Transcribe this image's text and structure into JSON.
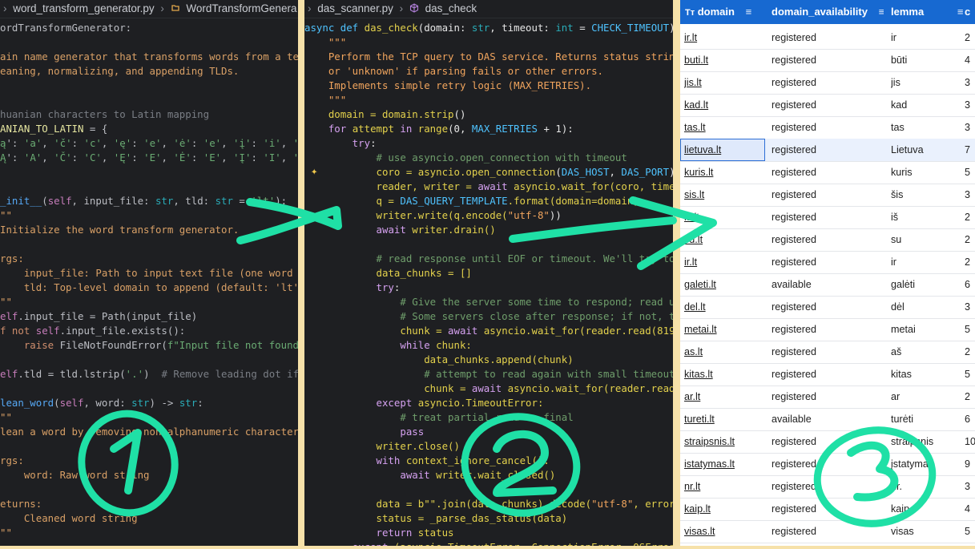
{
  "panel1": {
    "breadcrumb": {
      "file": "word_transform_generator.py",
      "symbol": "WordTransformGenera"
    },
    "lines": [
      [
        {
          "t": "ordTransformGenerator:",
          "c": "o"
        }
      ],
      [],
      [
        {
          "t": "ain name generator that transforms words from a text",
          "c": "d"
        }
      ],
      [
        {
          "t": "eaning, normalizing, and appending TLDs.",
          "c": "d"
        }
      ],
      [],
      [],
      [
        {
          "t": "huanian characters to Latin mapping",
          "c": "c"
        }
      ],
      [
        {
          "t": "ANIAN_TO_LATIN",
          "c": "y"
        },
        {
          "t": " = {",
          "c": "o"
        }
      ],
      [
        {
          "t": "ą",
          "c": "s"
        },
        {
          "t": "': ",
          "c": "o"
        },
        {
          "t": "'a'",
          "c": "s"
        },
        {
          "t": ", ",
          "c": "o"
        },
        {
          "t": "'č'",
          "c": "s"
        },
        {
          "t": ": ",
          "c": "o"
        },
        {
          "t": "'c'",
          "c": "s"
        },
        {
          "t": ", ",
          "c": "o"
        },
        {
          "t": "'ę'",
          "c": "s"
        },
        {
          "t": ": ",
          "c": "o"
        },
        {
          "t": "'e'",
          "c": "s"
        },
        {
          "t": ", ",
          "c": "o"
        },
        {
          "t": "'ė'",
          "c": "s"
        },
        {
          "t": ": ",
          "c": "o"
        },
        {
          "t": "'e'",
          "c": "s"
        },
        {
          "t": ", ",
          "c": "o"
        },
        {
          "t": "'į'",
          "c": "s"
        },
        {
          "t": ": ",
          "c": "o"
        },
        {
          "t": "'i'",
          "c": "s"
        },
        {
          "t": ", ",
          "c": "o"
        },
        {
          "t": "'š'",
          "c": "s"
        }
      ],
      [
        {
          "t": "Ą",
          "c": "s"
        },
        {
          "t": "': ",
          "c": "o"
        },
        {
          "t": "'A'",
          "c": "s"
        },
        {
          "t": ", ",
          "c": "o"
        },
        {
          "t": "'Č'",
          "c": "s"
        },
        {
          "t": ": ",
          "c": "o"
        },
        {
          "t": "'C'",
          "c": "s"
        },
        {
          "t": ", ",
          "c": "o"
        },
        {
          "t": "'Ę'",
          "c": "s"
        },
        {
          "t": ": ",
          "c": "o"
        },
        {
          "t": "'E'",
          "c": "s"
        },
        {
          "t": ", ",
          "c": "o"
        },
        {
          "t": "'Ė'",
          "c": "s"
        },
        {
          "t": ": ",
          "c": "o"
        },
        {
          "t": "'E'",
          "c": "s"
        },
        {
          "t": ", ",
          "c": "o"
        },
        {
          "t": "'Į'",
          "c": "s"
        },
        {
          "t": ": ",
          "c": "o"
        },
        {
          "t": "'I'",
          "c": "s"
        },
        {
          "t": ", ",
          "c": "o"
        },
        {
          "t": "'Š'",
          "c": "s"
        }
      ],
      [],
      [],
      [
        {
          "t": "_init__",
          "c": "f"
        },
        {
          "t": "(",
          "c": "o"
        },
        {
          "t": "self",
          "c": "m"
        },
        {
          "t": ", input_file: ",
          "c": "o"
        },
        {
          "t": "str",
          "c": "n"
        },
        {
          "t": ", tld: ",
          "c": "o"
        },
        {
          "t": "str",
          "c": "n"
        },
        {
          "t": " = ",
          "c": "o"
        },
        {
          "t": "'lt'",
          "c": "s"
        },
        {
          "t": "):",
          "c": "o"
        }
      ],
      [
        {
          "t": "\"\"",
          "c": "d"
        }
      ],
      [
        {
          "t": "Initialize the word transform generator.",
          "c": "d"
        }
      ],
      [],
      [
        {
          "t": "rgs:",
          "c": "d"
        }
      ],
      [
        {
          "t": "    input_file: Path to input text file (one word per",
          "c": "d"
        }
      ],
      [
        {
          "t": "    tld: Top-level domain to append (default: 'lt')",
          "c": "d"
        }
      ],
      [
        {
          "t": "\"\"",
          "c": "d"
        }
      ],
      [
        {
          "t": "elf",
          "c": "m"
        },
        {
          "t": ".input_file = Path(input_file)",
          "c": "o"
        }
      ],
      [
        {
          "t": "f ",
          "c": "k"
        },
        {
          "t": "not ",
          "c": "k"
        },
        {
          "t": "self",
          "c": "m"
        },
        {
          "t": ".input_file.exists():",
          "c": "o"
        }
      ],
      [
        {
          "t": "    ",
          "c": "o"
        },
        {
          "t": "raise ",
          "c": "k"
        },
        {
          "t": "FileNotFoundError(",
          "c": "o"
        },
        {
          "t": "f\"Input file not found: {",
          "c": "s"
        }
      ],
      [],
      [
        {
          "t": "elf",
          "c": "m"
        },
        {
          "t": ".tld = tld.lstrip(",
          "c": "o"
        },
        {
          "t": "'.'",
          "c": "s"
        },
        {
          "t": ")  ",
          "c": "o"
        },
        {
          "t": "# Remove leading dot if p",
          "c": "c"
        }
      ],
      [],
      [
        {
          "t": "lean_word",
          "c": "f"
        },
        {
          "t": "(",
          "c": "o"
        },
        {
          "t": "self",
          "c": "m"
        },
        {
          "t": ", word: ",
          "c": "o"
        },
        {
          "t": "str",
          "c": "n"
        },
        {
          "t": ") -> ",
          "c": "o"
        },
        {
          "t": "str",
          "c": "n"
        },
        {
          "t": ":",
          "c": "o"
        }
      ],
      [
        {
          "t": "\"\"",
          "c": "d"
        }
      ],
      [
        {
          "t": "lean a word by removing non-alphanumeric characters",
          "c": "d"
        }
      ],
      [],
      [
        {
          "t": "rgs:",
          "c": "d"
        }
      ],
      [
        {
          "t": "    word: Raw word string",
          "c": "d"
        }
      ],
      [],
      [
        {
          "t": "eturns:",
          "c": "d"
        }
      ],
      [
        {
          "t": "    Cleaned word string",
          "c": "d"
        }
      ],
      [
        {
          "t": "\"\"",
          "c": "d"
        }
      ]
    ]
  },
  "panel2": {
    "breadcrumb": {
      "file": "das_scanner.py",
      "symbol": "das_check"
    },
    "lines": [
      [
        {
          "t": "async ",
          "c": "bl"
        },
        {
          "t": "def ",
          "c": "bl"
        },
        {
          "t": "das_check",
          "c": "gy"
        },
        {
          "t": "(domain: ",
          "c": "wh"
        },
        {
          "t": "str",
          "c": "n"
        },
        {
          "t": ", timeout: ",
          "c": "wh"
        },
        {
          "t": "int",
          "c": "n"
        },
        {
          "t": " = ",
          "c": "wh"
        },
        {
          "t": "CHECK_TIMEOUT",
          "c": "bl"
        },
        {
          "t": ")",
          "c": "wh"
        }
      ],
      [
        {
          "t": "    \"\"\"",
          "c": "or"
        }
      ],
      [
        {
          "t": "    Perform the TCP query to DAS service. Returns status string",
          "c": "or"
        }
      ],
      [
        {
          "t": "    or 'unknown' if parsing fails or other errors.",
          "c": "or"
        }
      ],
      [
        {
          "t": "    Implements simple retry logic (MAX_RETRIES).",
          "c": "or"
        }
      ],
      [
        {
          "t": "    \"\"\"",
          "c": "or"
        }
      ],
      [
        {
          "t": "    domain = domain.",
          "c": "gy"
        },
        {
          "t": "strip",
          "c": "gy"
        },
        {
          "t": "()",
          "c": "wh"
        }
      ],
      [
        {
          "t": "    for ",
          "c": "pk"
        },
        {
          "t": "attempt ",
          "c": "gy"
        },
        {
          "t": "in ",
          "c": "pk"
        },
        {
          "t": "range",
          "c": "gy"
        },
        {
          "t": "(0, ",
          "c": "wh"
        },
        {
          "t": "MAX_RETRIES",
          "c": "bl"
        },
        {
          "t": " + 1):",
          "c": "wh"
        }
      ],
      [
        {
          "t": "        try",
          "c": "pk"
        },
        {
          "t": ":",
          "c": "wh"
        }
      ],
      [
        {
          "t": "            # use asyncio.open_connection with timeout",
          "c": "cmt"
        }
      ],
      [
        {
          "t": "            coro = asyncio.",
          "c": "gy"
        },
        {
          "t": "open_connection",
          "c": "gy"
        },
        {
          "t": "(",
          "c": "wh"
        },
        {
          "t": "DAS_HOST",
          "c": "bl"
        },
        {
          "t": ", ",
          "c": "wh"
        },
        {
          "t": "DAS_PORT",
          "c": "bl"
        },
        {
          "t": ")",
          "c": "wh"
        }
      ],
      [
        {
          "t": "            reader, writer = ",
          "c": "gy"
        },
        {
          "t": "await ",
          "c": "pk"
        },
        {
          "t": "asyncio.wait_for(coro, timeo",
          "c": "gy"
        }
      ],
      [
        {
          "t": "            q = ",
          "c": "gy"
        },
        {
          "t": "DAS_QUERY_TEMPLATE",
          "c": "bl"
        },
        {
          "t": ".format(domain=domain)",
          "c": "gy"
        }
      ],
      [
        {
          "t": "            writer.write(q.encode(",
          "c": "gy"
        },
        {
          "t": "\"utf-8\"",
          "c": "or"
        },
        {
          "t": "))",
          "c": "wh"
        }
      ],
      [
        {
          "t": "            ",
          "c": "wh"
        },
        {
          "t": "await ",
          "c": "pk"
        },
        {
          "t": "writer.drain()",
          "c": "gy"
        }
      ],
      [],
      [
        {
          "t": "            # read response until EOF or timeout. We'll try to",
          "c": "cmt"
        }
      ],
      [
        {
          "t": "            data_chunks = []",
          "c": "gy"
        }
      ],
      [
        {
          "t": "            try",
          "c": "pk"
        },
        {
          "t": ":",
          "c": "wh"
        }
      ],
      [
        {
          "t": "                # Give the server some time to respond; read un",
          "c": "cmt"
        }
      ],
      [
        {
          "t": "                # Some servers close after response; if not, th",
          "c": "cmt"
        }
      ],
      [
        {
          "t": "                chunk = ",
          "c": "gy"
        },
        {
          "t": "await ",
          "c": "pk"
        },
        {
          "t": "asyncio.wait_for(reader.read(8192",
          "c": "gy"
        }
      ],
      [
        {
          "t": "                while ",
          "c": "pk"
        },
        {
          "t": "chunk:",
          "c": "gy"
        }
      ],
      [
        {
          "t": "                    data_chunks.append(chunk)",
          "c": "gy"
        }
      ],
      [
        {
          "t": "                    # attempt to read again with small timeout",
          "c": "cmt"
        }
      ],
      [
        {
          "t": "                    chunk = ",
          "c": "gy"
        },
        {
          "t": "await ",
          "c": "pk"
        },
        {
          "t": "asyncio.wait_for(reader.read(",
          "c": "gy"
        }
      ],
      [
        {
          "t": "            except ",
          "c": "pk"
        },
        {
          "t": "asyncio.TimeoutError:",
          "c": "gy"
        }
      ],
      [
        {
          "t": "                # treat partial read as final",
          "c": "cmt"
        }
      ],
      [
        {
          "t": "                pass",
          "c": "pk"
        }
      ],
      [
        {
          "t": "            writer.close()",
          "c": "gy"
        }
      ],
      [
        {
          "t": "            with ",
          "c": "pk"
        },
        {
          "t": "context_ignore_cancel():",
          "c": "gy"
        }
      ],
      [
        {
          "t": "                ",
          "c": "wh"
        },
        {
          "t": "await ",
          "c": "pk"
        },
        {
          "t": "writer.wait_closed()",
          "c": "gy"
        }
      ],
      [],
      [
        {
          "t": "            data = b\"\".join(data_chunks).decode(",
          "c": "gy"
        },
        {
          "t": "\"utf-8\"",
          "c": "or"
        },
        {
          "t": ", errors",
          "c": "gy"
        }
      ],
      [
        {
          "t": "            status = _parse_das_status(data)",
          "c": "gy"
        }
      ],
      [
        {
          "t": "            return ",
          "c": "pk"
        },
        {
          "t": "status",
          "c": "gy"
        }
      ],
      [
        {
          "t": "        except ",
          "c": "pk"
        },
        {
          "t": "(asyncio.TimeoutError, ConnectionError, OSError)",
          "c": "gy"
        }
      ]
    ]
  },
  "table": {
    "headers": [
      "domain",
      "domain_availability",
      "lemma",
      "c"
    ],
    "type_icon": "Tт",
    "rows": [
      [
        "ir.lt",
        "registered",
        "ir",
        "2"
      ],
      [
        "buti.lt",
        "registered",
        "būti",
        "4"
      ],
      [
        "jis.lt",
        "registered",
        "jis",
        "3"
      ],
      [
        "kad.lt",
        "registered",
        "kad",
        "3"
      ],
      [
        "tas.lt",
        "registered",
        "tas",
        "3"
      ],
      [
        "lietuva.lt",
        "registered",
        "Lietuva",
        "7"
      ],
      [
        "kuris.lt",
        "registered",
        "kuris",
        "5"
      ],
      [
        "sis.lt",
        "registered",
        "šis",
        "3"
      ],
      [
        "is.lt",
        "registered",
        "iš",
        "2"
      ],
      [
        "su.lt",
        "registered",
        "su",
        "2"
      ],
      [
        "ir.lt",
        "registered",
        "ir",
        "2"
      ],
      [
        "galeti.lt",
        "available",
        "galėti",
        "6"
      ],
      [
        "del.lt",
        "registered",
        "dėl",
        "3"
      ],
      [
        "metai.lt",
        "registered",
        "metai",
        "5"
      ],
      [
        "as.lt",
        "registered",
        "aš",
        "2"
      ],
      [
        "kitas.lt",
        "registered",
        "kitas",
        "5"
      ],
      [
        "ar.lt",
        "registered",
        "ar",
        "2"
      ],
      [
        "tureti.lt",
        "available",
        "turėti",
        "6"
      ],
      [
        "straipsnis.lt",
        "registered",
        "straipsnis",
        "10"
      ],
      [
        "istatymas.lt",
        "registered",
        "įstatymas",
        "9"
      ],
      [
        "nr.lt",
        "registered",
        "nr.",
        "3"
      ],
      [
        "kaip.lt",
        "registered",
        "kaip",
        "4"
      ],
      [
        "visas.lt",
        "registered",
        "visas",
        "5"
      ]
    ],
    "selected_row": 5
  },
  "colors": {
    "accent_header": "#1769d1",
    "annotation": "#1fe0a6",
    "frame": "#f6e1a9"
  },
  "annotations": {
    "one": "1",
    "two": "2",
    "three": "3"
  }
}
